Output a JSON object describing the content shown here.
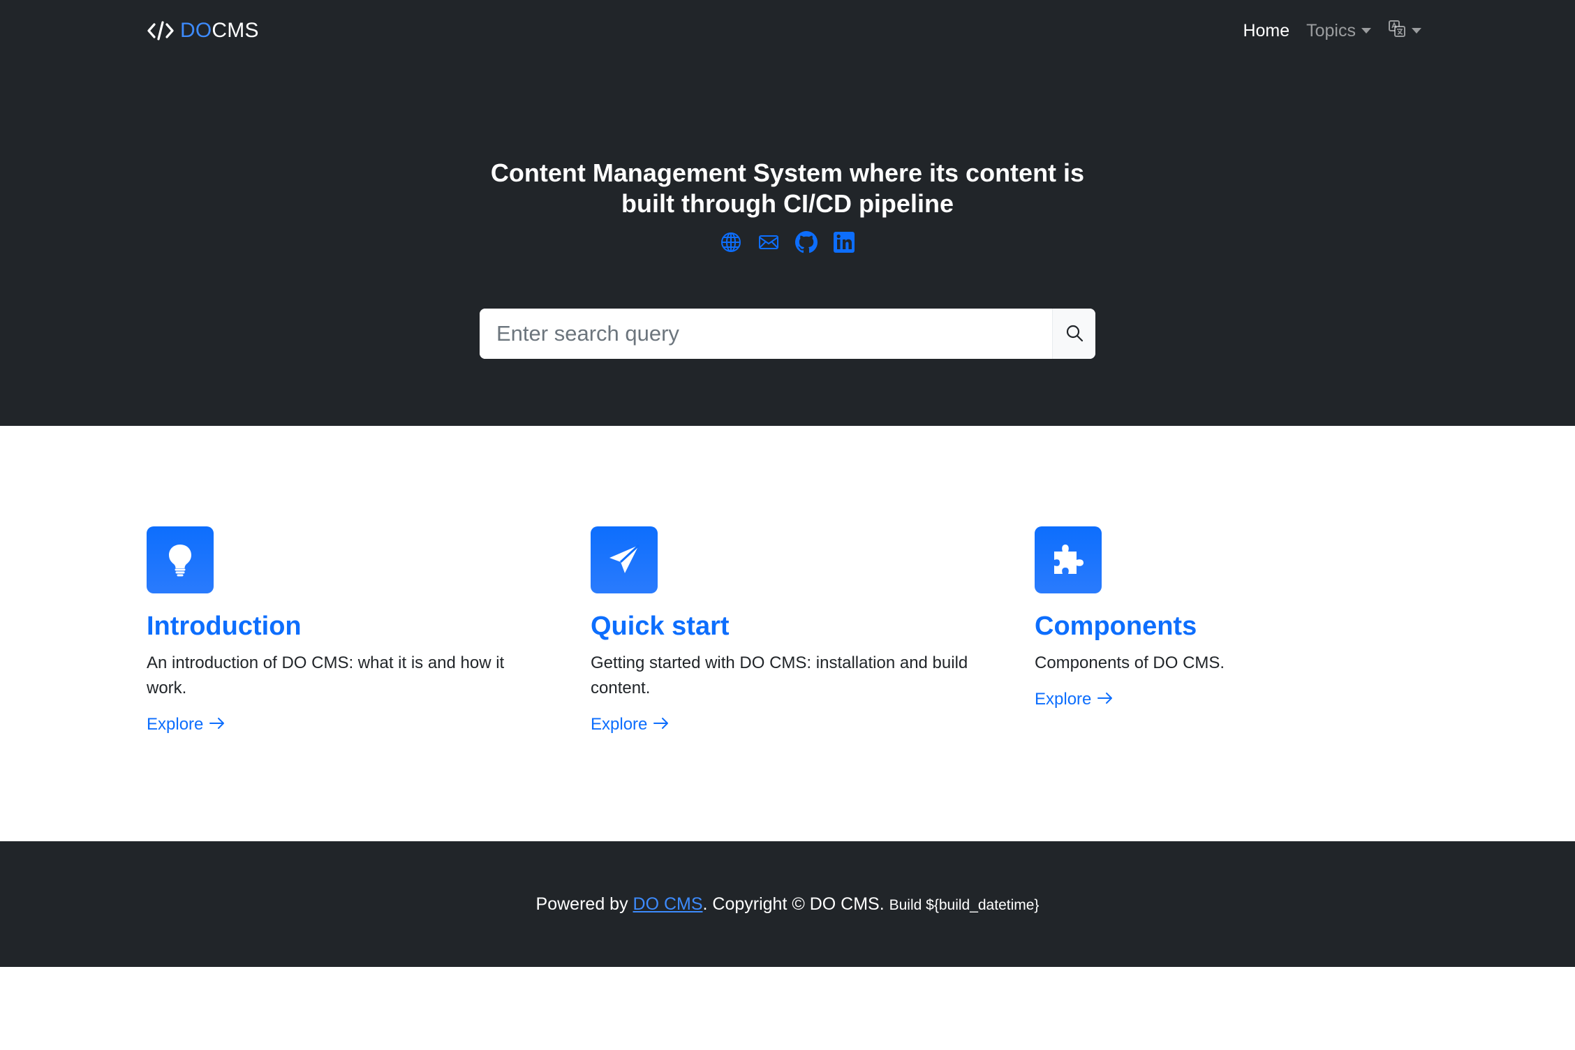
{
  "brand": {
    "prefix": "DO",
    "suffix": "CMS"
  },
  "nav": {
    "home": "Home",
    "topics": "Topics"
  },
  "hero": {
    "title_line1": "Content Management System where its content is",
    "title_line2": "built through CI/CD pipeline"
  },
  "social": [
    "globe-icon",
    "envelope-icon",
    "github-icon",
    "linkedin-icon"
  ],
  "search": {
    "placeholder": "Enter search query",
    "value": ""
  },
  "features": [
    {
      "title": "Introduction",
      "description": "An introduction of DO CMS: what it is and how it work.",
      "link": "Explore",
      "icon": "lightbulb-icon"
    },
    {
      "title": "Quick start",
      "description": "Getting started with DO CMS: installation and build content.",
      "link": "Explore",
      "icon": "send-icon"
    },
    {
      "title": "Components",
      "description": "Components of DO CMS.",
      "link": "Explore",
      "icon": "puzzle-icon"
    }
  ],
  "footer": {
    "powered_by": "Powered by ",
    "link": "DO CMS",
    "copyright": ". Copyright © DO CMS. ",
    "build": "Build ${build_datetime}"
  },
  "colors": {
    "dark": "#212529",
    "primary": "#0d6efd",
    "link_light": "#3d8bfd"
  }
}
